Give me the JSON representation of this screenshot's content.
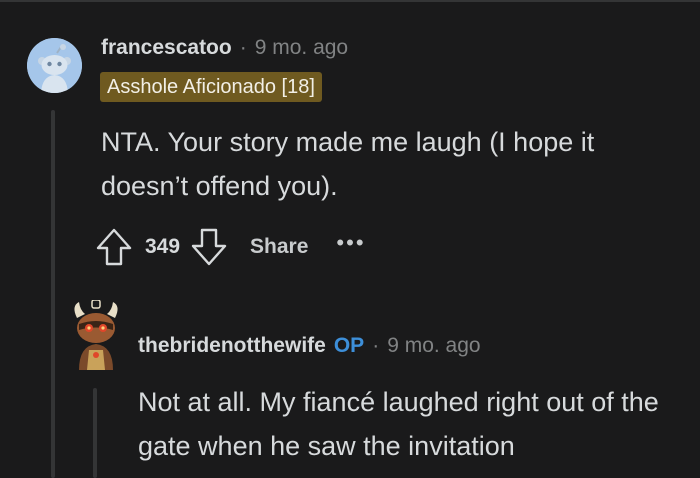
{
  "comments": [
    {
      "username": "francescatoo",
      "separator": "·",
      "time": "9 mo. ago",
      "flair": "Asshole Aficionado [18]",
      "body": "NTA. Your story made me laugh (I hope it doesn’t offend you).",
      "score": "349",
      "share_label": "Share",
      "more_label": "•••",
      "avatar_icon": "reddit-snoo-default-avatar",
      "colors": {
        "avatar_bg": "#a5c6ea",
        "flair_bg": "#6f5a20"
      }
    },
    {
      "username": "thebridenotthewife",
      "op_badge": "OP",
      "separator": "·",
      "time": "9 mo. ago",
      "body": "Not at all. My fiancé laughed right out of the gate when he saw the invitation",
      "avatar_icon": "reddit-custom-snoo-avatar",
      "colors": {
        "op": "#3d8fd9"
      }
    }
  ],
  "icons": {
    "upvote": "arrow-up-outline-icon",
    "downvote": "arrow-down-outline-icon",
    "more": "ellipsis-icon"
  },
  "theme": {
    "background": "#1a1a1b",
    "text": "#d7dadc",
    "muted": "#818384"
  }
}
